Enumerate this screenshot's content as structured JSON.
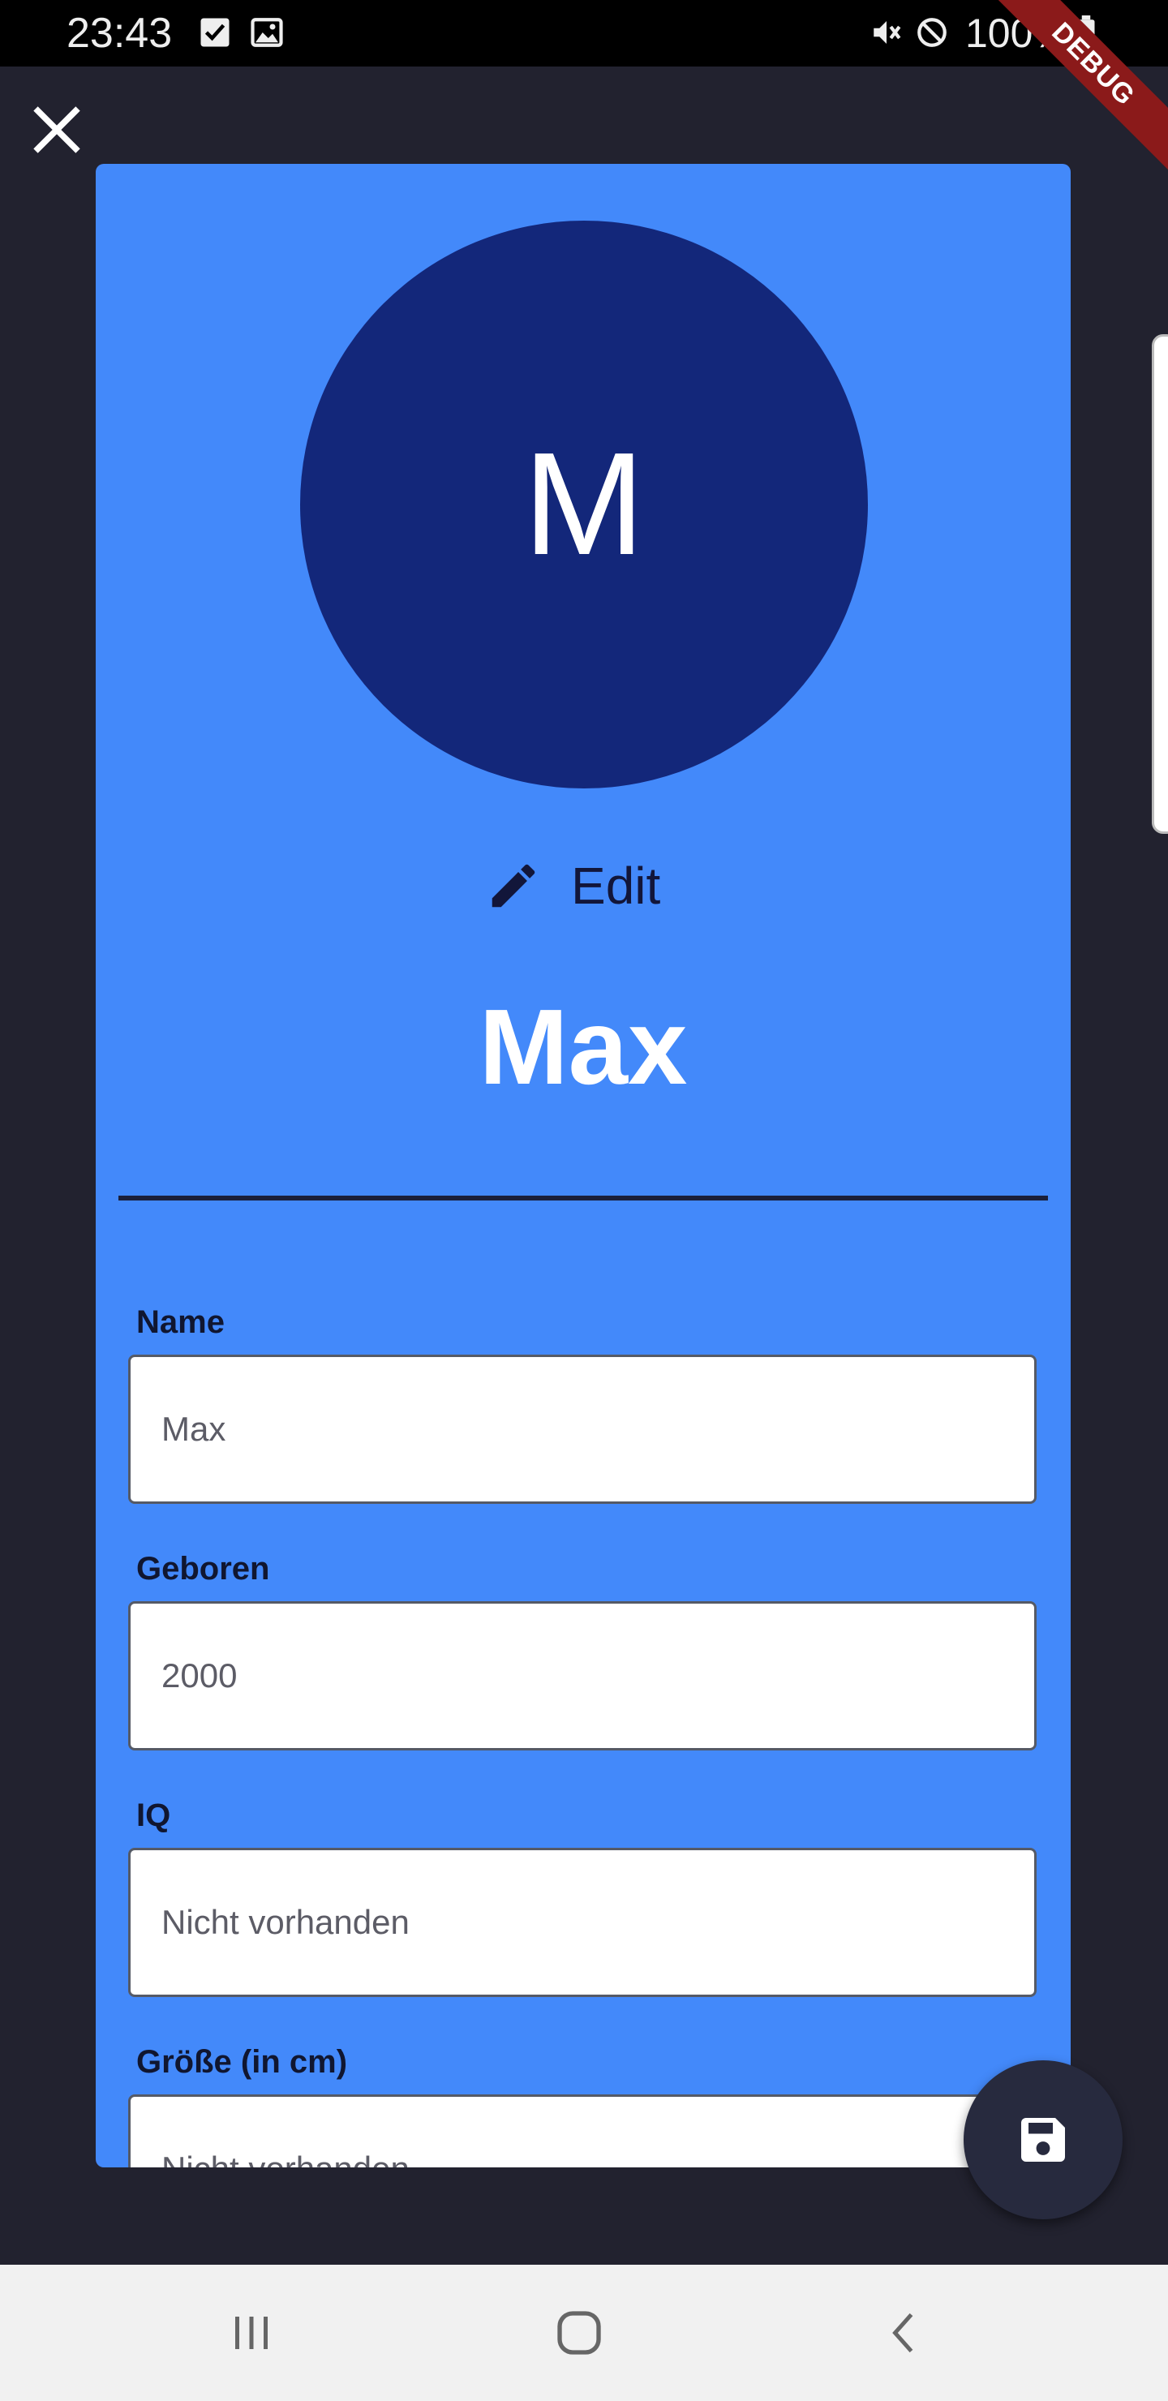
{
  "status_bar": {
    "time": "23:43",
    "battery": "100%",
    "icons": [
      "checkbox-notification-icon",
      "image-notification-icon",
      "mute-icon",
      "do-not-disturb-icon",
      "battery-icon"
    ]
  },
  "debug_banner": "DEBUG",
  "profile": {
    "avatar_initial": "M",
    "edit_label": "Edit",
    "name": "Max"
  },
  "form": {
    "fields": [
      {
        "label": "Name",
        "value": "Max"
      },
      {
        "label": "Geboren",
        "value": "2000"
      },
      {
        "label": "IQ",
        "value": "Nicht vorhanden"
      },
      {
        "label": "Größe (in cm)",
        "value": "Nicht vorhanden"
      }
    ]
  },
  "colors": {
    "background": "#22222f",
    "card": "#4389fa",
    "avatar": "#13277a",
    "fab": "#272a3e",
    "debug_banner": "#8b1a1a"
  }
}
